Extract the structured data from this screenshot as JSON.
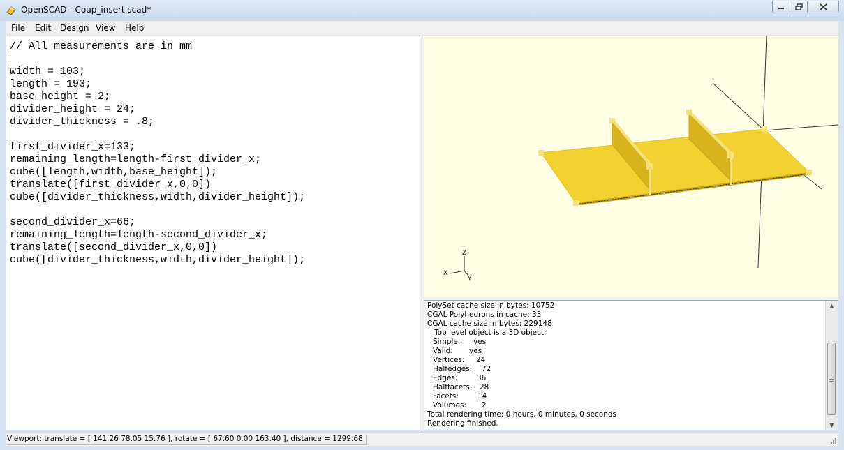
{
  "window": {
    "title": "OpenSCAD - Coup_insert.scad*",
    "icon": "openscad-app-icon"
  },
  "menu": [
    "File",
    "Edit",
    "Design",
    "View",
    "Help"
  ],
  "editor": {
    "code": "// All measurements are in mm\n\nwidth = 103;\nlength = 193;\nbase_height = 2;\ndivider_height = 24;\ndivider_thickness = .8;\n\nfirst_divider_x=133;\nremaining_length=length-first_divider_x;\ncube([length,width,base_height]);\ntranslate([first_divider_x,0,0])\ncube([divider_thickness,width,divider_height]);\n\nsecond_divider_x=66;\nremaining_length=length-second_divider_x;\ntranslate([second_divider_x,0,0])\ncube([divider_thickness,width,divider_height]);"
  },
  "viewer": {
    "axis_labels": {
      "z": "Z",
      "x": "X",
      "y": "Y"
    },
    "colors": {
      "background": "#ffffe5",
      "model": "#f2d231",
      "model_dark": "#d9b31c",
      "axis": "#333333"
    }
  },
  "console": {
    "lines": [
      "PolySet cache size in bytes: 10752",
      "CGAL Polyhedrons in cache: 33",
      "CGAL cache size in bytes: 229148",
      "   Top level object is a 3D object:"
    ],
    "stats": [
      {
        "k": "Simple:",
        "v": "yes"
      },
      {
        "k": "Valid:",
        "v": "yes"
      },
      {
        "k": "Vertices:",
        "v": "24"
      },
      {
        "k": "Halfedges:",
        "v": "72"
      },
      {
        "k": "Edges:",
        "v": "36"
      },
      {
        "k": "Halffacets:",
        "v": "28"
      },
      {
        "k": "Facets:",
        "v": "14"
      },
      {
        "k": "Volumes:",
        "v": "2"
      }
    ],
    "tail": [
      "Total rendering time: 0 hours, 0 minutes, 0 seconds",
      "Rendering finished."
    ]
  },
  "status": {
    "viewport": "Viewport: translate = [ 141.26 78.05 15.76 ], rotate = [ 67.60 0.00 163.40 ], distance = 1299.68"
  }
}
